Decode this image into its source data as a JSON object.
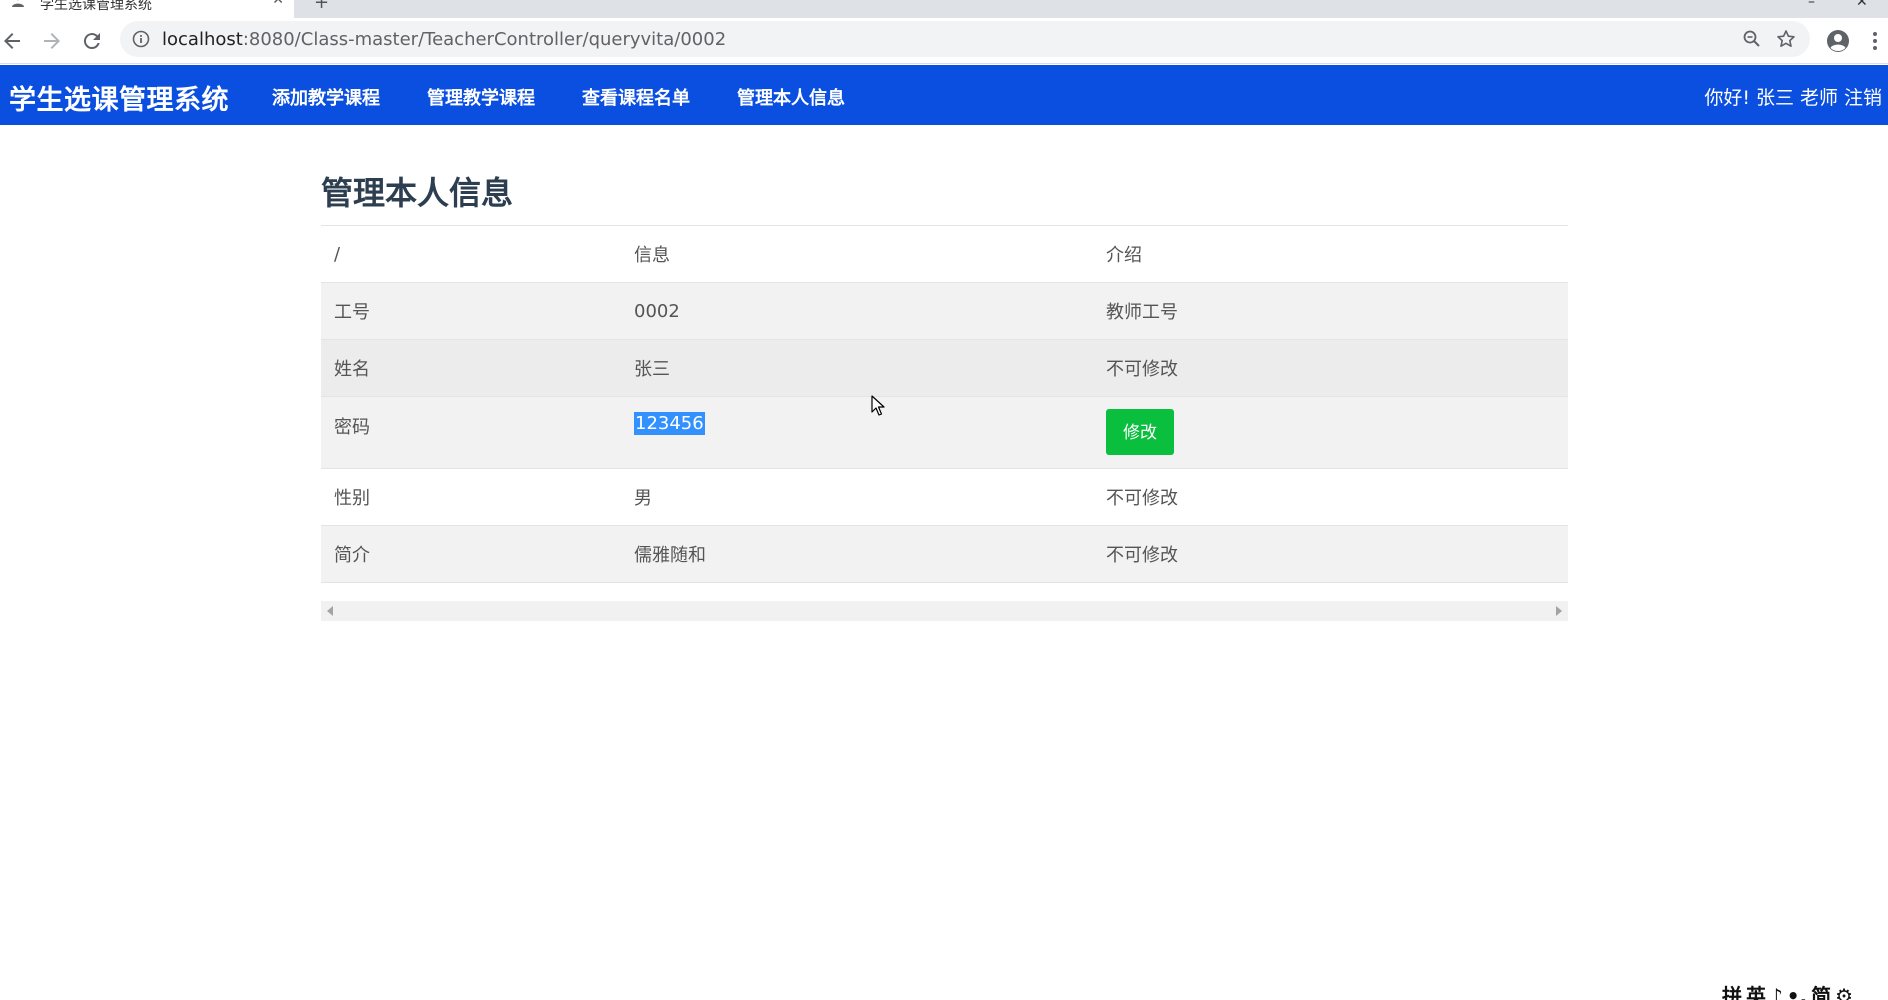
{
  "browser": {
    "tab_title": "学生选课管理系统",
    "tab_close": "✕",
    "new_tab": "+",
    "url_host": "localhost",
    "url_rest": ":8080/Class-master/TeacherController/queryvita/0002"
  },
  "navbar": {
    "brand": "学生选课管理系统",
    "links": [
      {
        "label": "添加教学课程"
      },
      {
        "label": "管理教学课程"
      },
      {
        "label": "查看课程名单"
      },
      {
        "label": "管理本人信息"
      }
    ],
    "greeting": "你好!",
    "username": "张三",
    "role": "老师",
    "logout": "注销"
  },
  "main": {
    "title": "管理本人信息",
    "table": {
      "header": [
        "/",
        "信息",
        "介绍"
      ],
      "rows": [
        {
          "field": "工号",
          "value": "0002",
          "note": "教师工号"
        },
        {
          "field": "姓名",
          "value": "张三",
          "note": "不可修改"
        },
        {
          "field": "密码",
          "value": "123456",
          "action": "修改"
        },
        {
          "field": "性别",
          "value": "男",
          "note": "不可修改"
        },
        {
          "field": "简介",
          "value": "儒雅随和",
          "note": "不可修改"
        }
      ]
    }
  },
  "ime": {
    "items": [
      "拼",
      "英",
      "♪",
      "•,",
      "简",
      "⚙"
    ]
  },
  "colors": {
    "navbar": "#0b4fe0",
    "button_green": "#0bbf3e",
    "selection": "#3390ff"
  }
}
